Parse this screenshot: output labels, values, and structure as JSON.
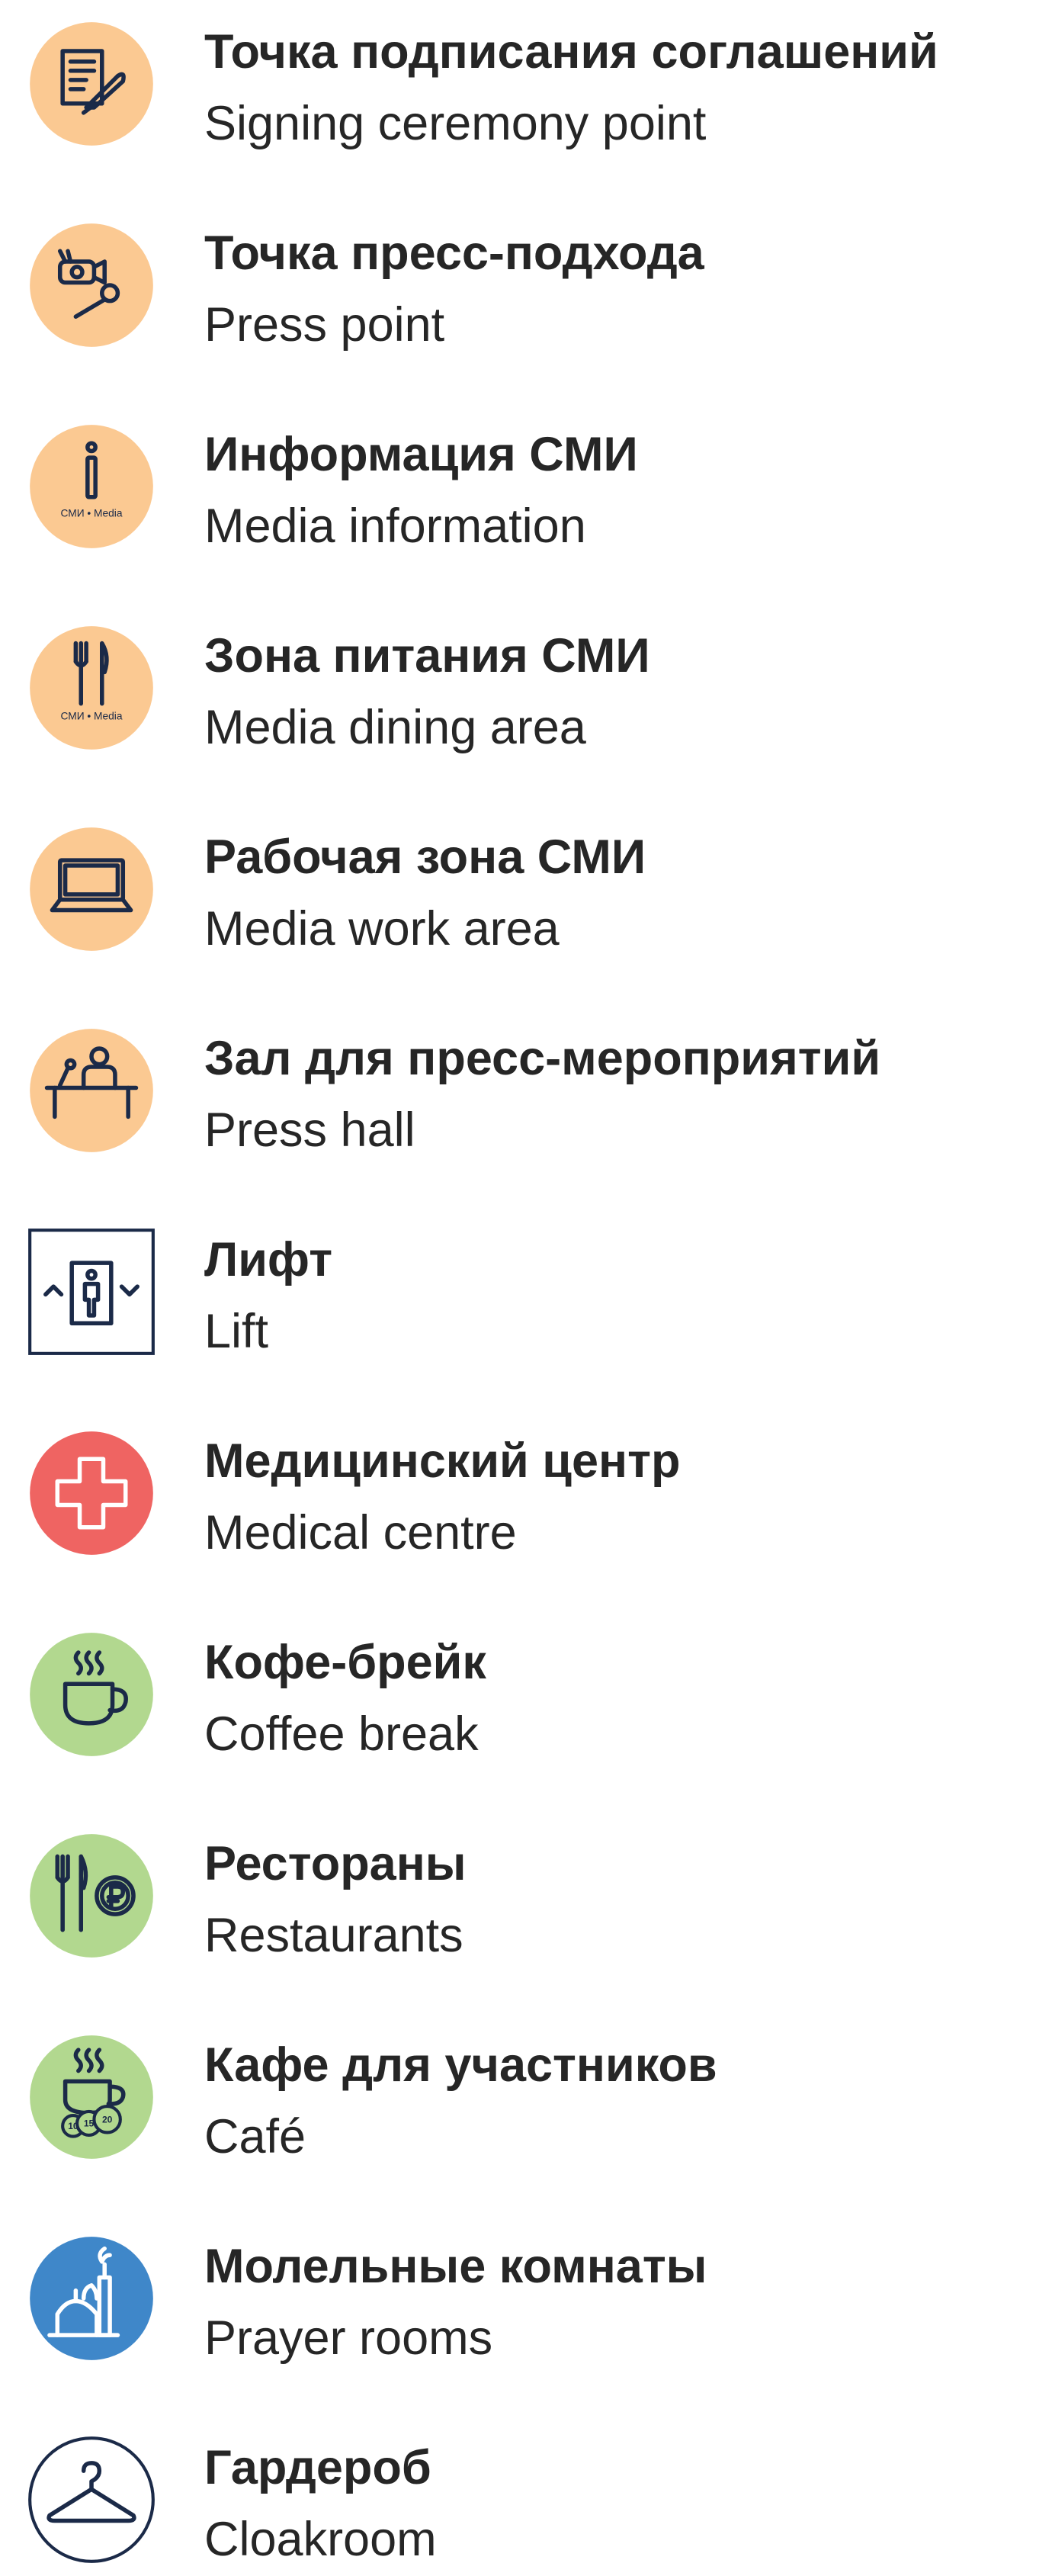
{
  "colors": {
    "press": "#fbc992",
    "medical": "#ef6462",
    "food": "#b2d88f",
    "prayer": "#3f87c9",
    "line": "#1b2a48",
    "text": "#262626"
  },
  "items": [
    {
      "icon": "signing-document-icon",
      "ru": "Точка подписания соглашений",
      "en": "Signing ceremony point"
    },
    {
      "icon": "press-camera-microphone-icon",
      "ru": "Точка пресс-подхода",
      "en": "Press point"
    },
    {
      "icon": "media-information-icon",
      "ru": "Информация СМИ",
      "en": "Media information",
      "badge": "СМИ • Media"
    },
    {
      "icon": "media-dining-icon",
      "ru": "Зона питания СМИ",
      "en": "Media dining area",
      "badge": "СМИ • Media"
    },
    {
      "icon": "laptop-icon",
      "ru": "Рабочая зона СМИ",
      "en": "Media work area"
    },
    {
      "icon": "press-hall-speaker-icon",
      "ru": "Зал для пресс-мероприятий",
      "en": "Press hall"
    },
    {
      "icon": "lift-icon",
      "ru": "Лифт",
      "en": "Lift"
    },
    {
      "icon": "medical-cross-icon",
      "ru": "Медицинский центр",
      "en": "Medical centre"
    },
    {
      "icon": "coffee-cup-icon",
      "ru": "Кофе-брейк",
      "en": "Coffee break"
    },
    {
      "icon": "restaurant-cutlery-ruble-icon",
      "ru": "Рестораны",
      "en": "Restaurants"
    },
    {
      "icon": "cafe-coins-icon",
      "ru": "Кафе для участников",
      "en": "Café",
      "coins": [
        "10",
        "15",
        "20"
      ]
    },
    {
      "icon": "prayer-room-icon",
      "ru": "Молельные комнаты",
      "en": "Prayer rooms"
    },
    {
      "icon": "hanger-icon",
      "ru": "Гардероб",
      "en": "Cloakroom"
    }
  ]
}
